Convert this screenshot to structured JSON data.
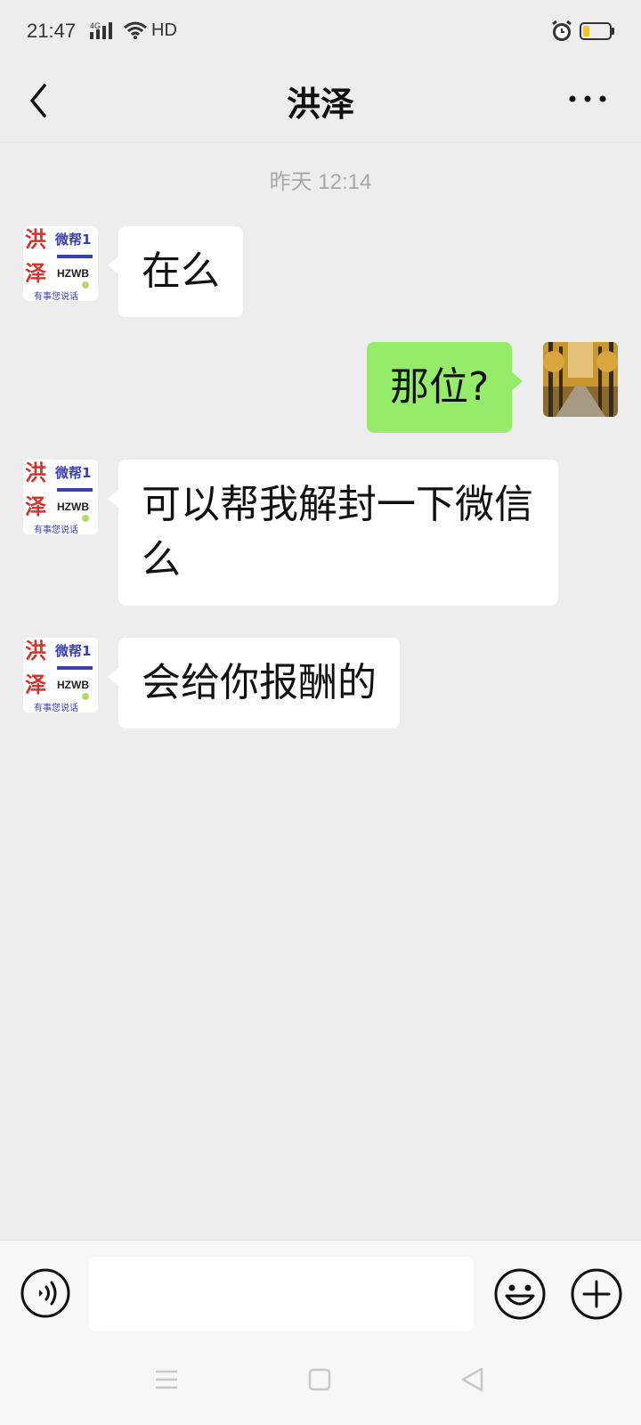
{
  "status_bar": {
    "time": "21:47",
    "network_label": "4G",
    "hd_label": "HD",
    "icons": [
      "signal-icon",
      "wifi-icon",
      "alarm-icon",
      "battery-icon"
    ],
    "battery_level": 0.25,
    "battery_color": "#f5c518"
  },
  "header": {
    "title": "洪泽",
    "back_icon": "chevron-left-icon",
    "more_icon": "more-icon"
  },
  "chat": {
    "timestamp": "昨天 12:14",
    "contact_avatar": {
      "big_char_1": "洪",
      "big_char_2": "泽",
      "small_text": "微帮1",
      "code": "HZWB",
      "slogan": "有事您说话"
    },
    "messages": [
      {
        "side": "incoming",
        "text": "在么"
      },
      {
        "side": "outgoing",
        "text": "那位?"
      },
      {
        "side": "incoming",
        "text": "可以帮我解封一下微信么"
      },
      {
        "side": "incoming",
        "text": "会给你报酬的"
      }
    ],
    "colors": {
      "background": "#ededed",
      "incoming_bubble": "#ffffff",
      "outgoing_bubble": "#95ec69"
    }
  },
  "input_bar": {
    "value": "",
    "icons": [
      "voice-icon",
      "emoji-icon",
      "plus-icon"
    ]
  },
  "nav_bar": {
    "icons": [
      "menu-icon",
      "home-icon",
      "back-triangle-icon"
    ]
  }
}
